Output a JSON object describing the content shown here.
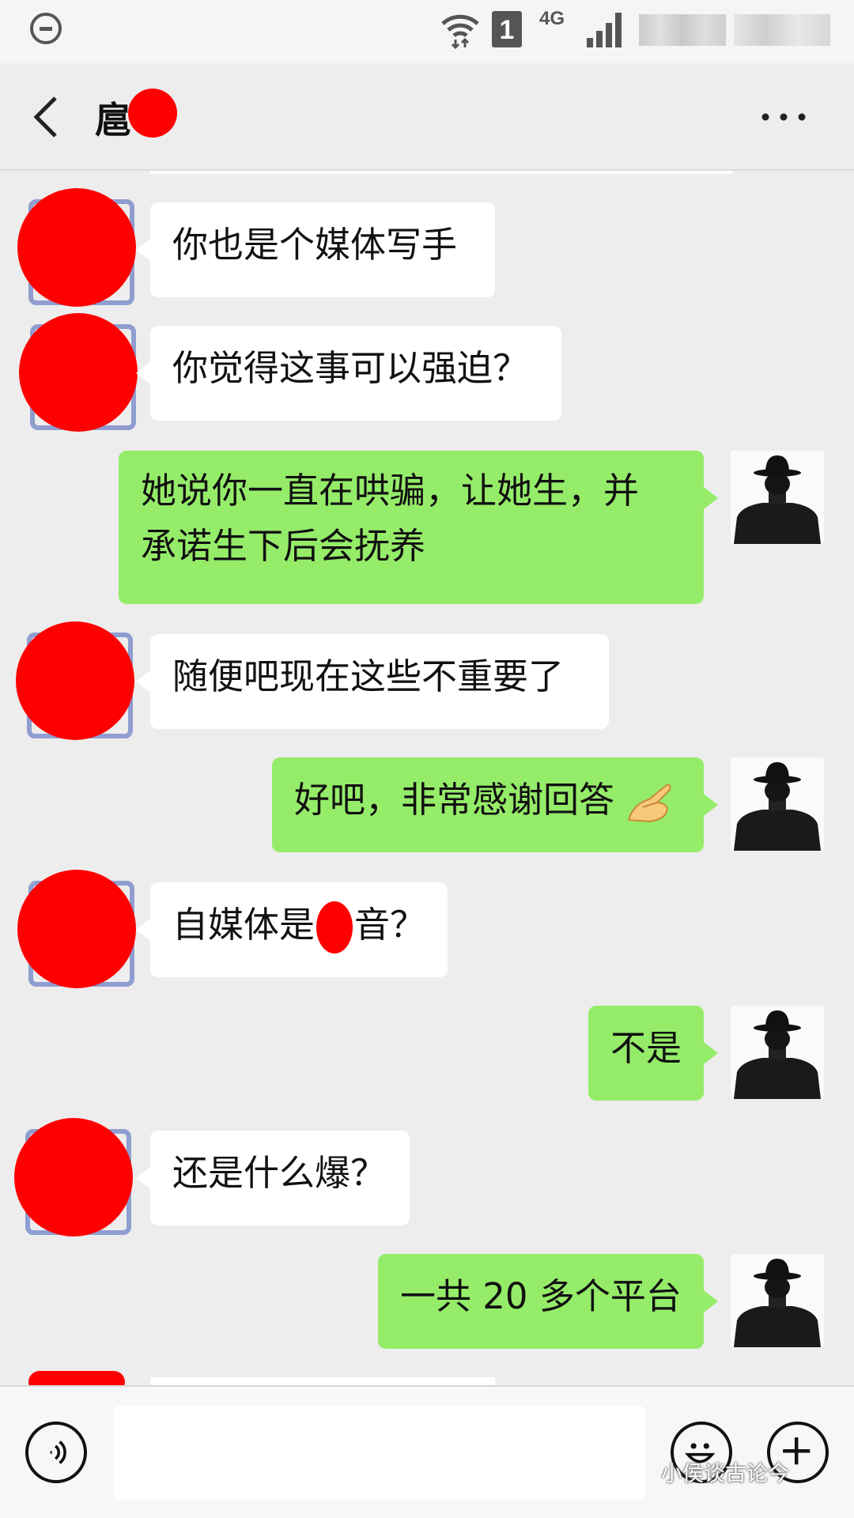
{
  "status_bar": {
    "sim_slot": "1",
    "network": "4G"
  },
  "header": {
    "title": "扈",
    "back_icon": "chevron-left-icon",
    "more_icon": "more-dots-icon"
  },
  "messages": [
    {
      "side": "in",
      "text": "你也是个媒体写手"
    },
    {
      "side": "in",
      "text": "你觉得这事可以强迫？"
    },
    {
      "side": "out",
      "text": "她说你一直在哄骗，让她生，并",
      "text2": "承诺生下后会抚养"
    },
    {
      "side": "in",
      "text": "随便吧现在这些不重要了"
    },
    {
      "side": "out",
      "text": "好吧，非常感谢回答"
    },
    {
      "side": "in",
      "text_before": "自媒体是",
      "text_after": "音？"
    },
    {
      "side": "out",
      "text": "不是"
    },
    {
      "side": "in",
      "text": "还是什么爆？"
    },
    {
      "side": "out",
      "text": "一共 20 多个平台"
    }
  ],
  "input_bar": {
    "voice_icon": "voice-icon",
    "emoji_icon": "emoji-icon",
    "plus_icon": "plus-icon",
    "watermark": "小侯谈古论今"
  },
  "colors": {
    "outgoing_bubble": "#95ec69",
    "incoming_bubble": "#ffffff",
    "background": "#ededed",
    "redaction": "#ff0000"
  }
}
